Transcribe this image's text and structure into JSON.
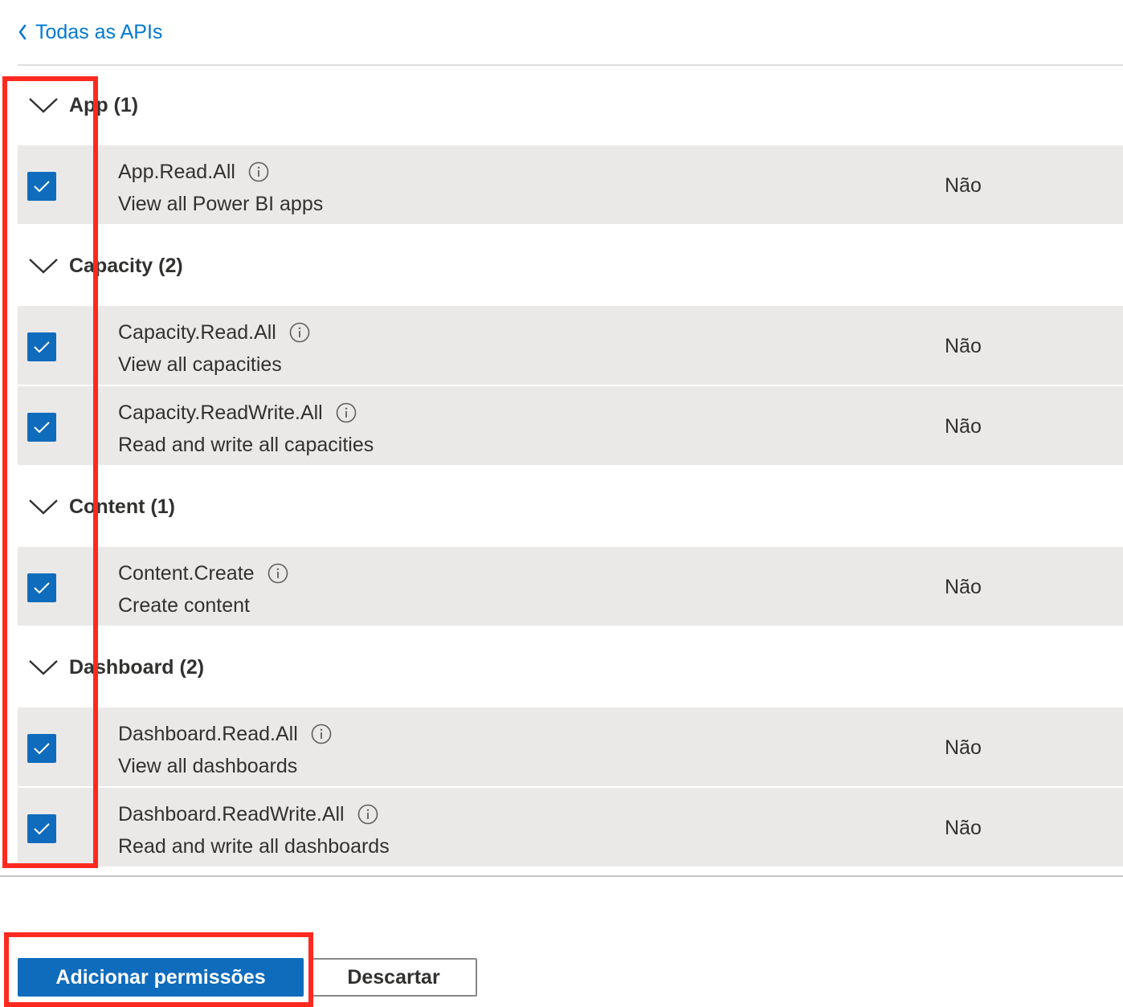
{
  "nav": {
    "back_label": "Todas as APIs"
  },
  "groups": [
    {
      "title": "App (1)",
      "permissions": [
        {
          "name": "App.Read.All",
          "description": "View all Power BI apps",
          "admin_consent": "Não",
          "checked": true
        }
      ]
    },
    {
      "title": "Capacity (2)",
      "permissions": [
        {
          "name": "Capacity.Read.All",
          "description": "View all capacities",
          "admin_consent": "Não",
          "checked": true
        },
        {
          "name": "Capacity.ReadWrite.All",
          "description": "Read and write all capacities",
          "admin_consent": "Não",
          "checked": true
        }
      ]
    },
    {
      "title": "Content (1)",
      "permissions": [
        {
          "name": "Content.Create",
          "description": "Create content",
          "admin_consent": "Não",
          "checked": true
        }
      ]
    },
    {
      "title": "Dashboard (2)",
      "permissions": [
        {
          "name": "Dashboard.Read.All",
          "description": "View all dashboards",
          "admin_consent": "Não",
          "checked": true
        },
        {
          "name": "Dashboard.ReadWrite.All",
          "description": "Read and write all dashboards",
          "admin_consent": "Não",
          "checked": true
        }
      ]
    }
  ],
  "footer": {
    "add_label": "Adicionar permissões",
    "discard_label": "Descartar"
  },
  "colors": {
    "accent": "#0f6cbd",
    "link": "#0078d4",
    "row_background": "#ebe9e7",
    "annotation": "#ff2a1f"
  },
  "icons": {
    "back": "chevron-left-icon",
    "group_toggle": "chevron-down-icon",
    "info": "info-icon",
    "checkbox": "checkmark-icon"
  }
}
